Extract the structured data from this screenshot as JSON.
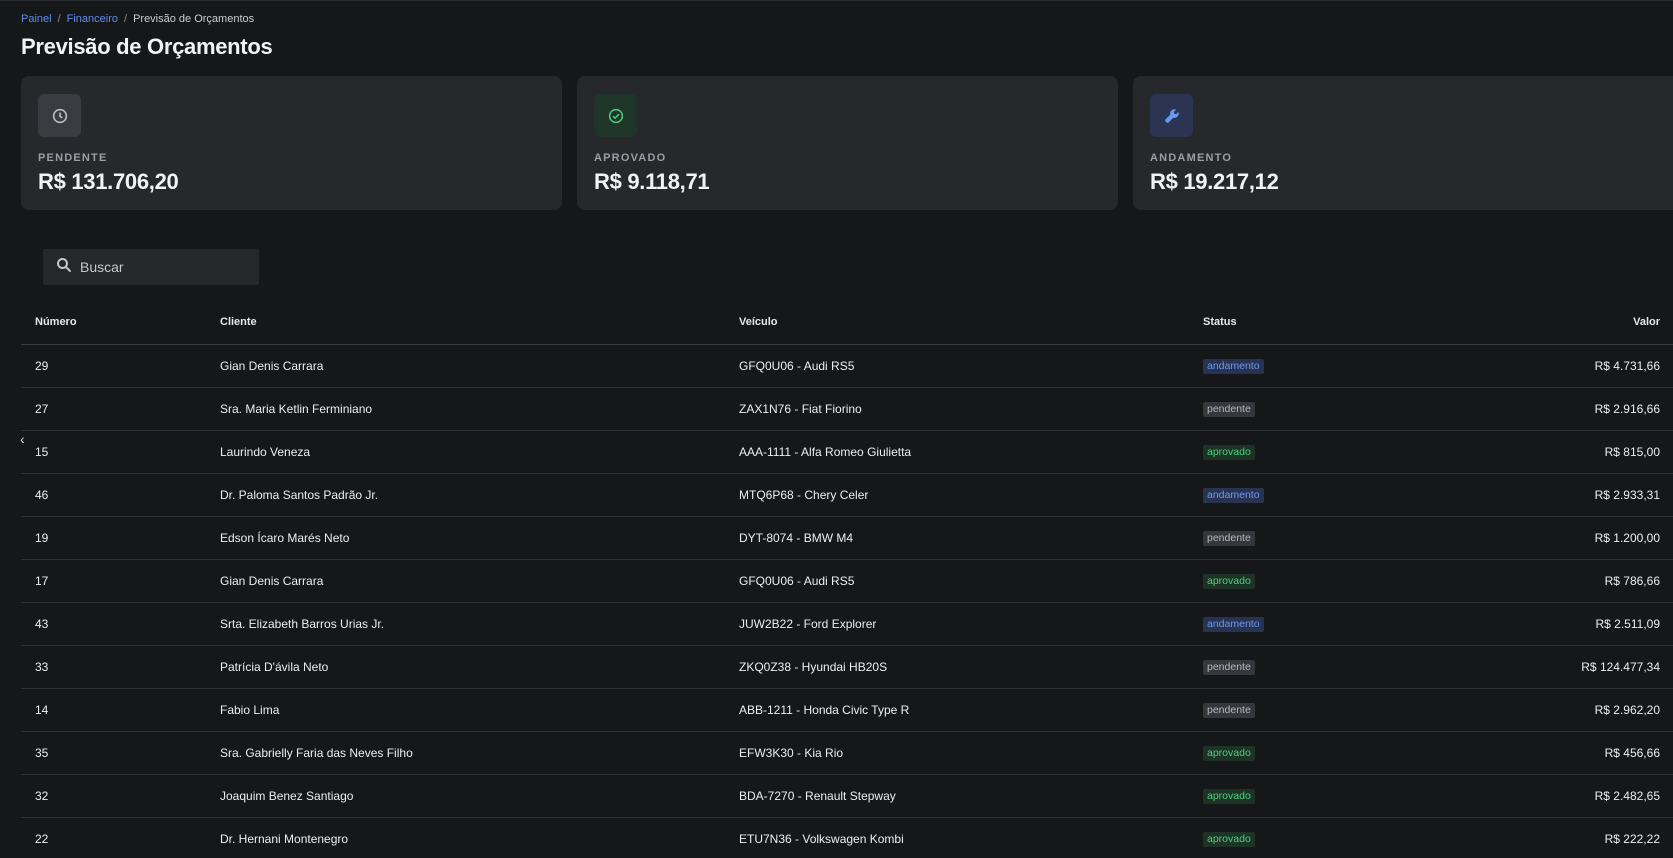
{
  "breadcrumb": {
    "items": [
      "Painel",
      "Financeiro"
    ],
    "current": "Previsão de Orçamentos",
    "separator": "/"
  },
  "page_title": "Previsão de Orçamentos",
  "cards": [
    {
      "key": "pendente",
      "icon": "clock-icon",
      "label": "PENDENTE",
      "value": "R$ 131.706,20"
    },
    {
      "key": "aprovado",
      "icon": "check-circle-icon",
      "label": "APROVADO",
      "value": "R$ 9.118,71"
    },
    {
      "key": "andamento",
      "icon": "wrench-icon",
      "label": "ANDAMENTO",
      "value": "R$ 19.217,12"
    }
  ],
  "search": {
    "placeholder": "Buscar",
    "value": ""
  },
  "table": {
    "headers": {
      "numero": "Número",
      "cliente": "Cliente",
      "veiculo": "Veículo",
      "status": "Status",
      "valor": "Valor"
    },
    "rows": [
      {
        "numero": "29",
        "cliente": "Gian Denis Carrara",
        "veiculo": "GFQ0U06 - Audi RS5",
        "status": "andamento",
        "valor": "R$ 4.731,66"
      },
      {
        "numero": "27",
        "cliente": "Sra. Maria Ketlin Ferminiano",
        "veiculo": "ZAX1N76 - Fiat Fiorino",
        "status": "pendente",
        "valor": "R$ 2.916,66"
      },
      {
        "numero": "15",
        "cliente": "Laurindo Veneza",
        "veiculo": "AAA-1111 - Alfa Romeo Giulietta",
        "status": "aprovado",
        "valor": "R$ 815,00"
      },
      {
        "numero": "46",
        "cliente": "Dr. Paloma Santos Padrão Jr.",
        "veiculo": "MTQ6P68 - Chery Celer",
        "status": "andamento",
        "valor": "R$ 2.933,31"
      },
      {
        "numero": "19",
        "cliente": "Edson Ícaro Marés Neto",
        "veiculo": "DYT-8074 - BMW M4",
        "status": "pendente",
        "valor": "R$ 1.200,00"
      },
      {
        "numero": "17",
        "cliente": "Gian Denis Carrara",
        "veiculo": "GFQ0U06 - Audi RS5",
        "status": "aprovado",
        "valor": "R$ 786,66"
      },
      {
        "numero": "43",
        "cliente": "Srta. Elizabeth Barros Urias Jr.",
        "veiculo": "JUW2B22 - Ford Explorer",
        "status": "andamento",
        "valor": "R$ 2.511,09"
      },
      {
        "numero": "33",
        "cliente": "Patrícia D'ávila Neto",
        "veiculo": "ZKQ0Z38 - Hyundai HB20S",
        "status": "pendente",
        "valor": "R$ 124.477,34"
      },
      {
        "numero": "14",
        "cliente": "Fabio Lima",
        "veiculo": "ABB-1211 - Honda Civic Type R",
        "status": "pendente",
        "valor": "R$ 2.962,20"
      },
      {
        "numero": "35",
        "cliente": "Sra. Gabrielly Faria das Neves Filho",
        "veiculo": "EFW3K30 - Kia Rio",
        "status": "aprovado",
        "valor": "R$ 456,66"
      },
      {
        "numero": "32",
        "cliente": "Joaquim Benez Santiago",
        "veiculo": "BDA-7270 - Renault Stepway",
        "status": "aprovado",
        "valor": "R$ 2.482,65"
      },
      {
        "numero": "22",
        "cliente": "Dr. Hernani Montenegro",
        "veiculo": "ETU7N36 - Volkswagen Kombi",
        "status": "aprovado",
        "valor": "R$ 222,22"
      }
    ]
  },
  "colors": {
    "background": "#161719",
    "card": "#26282c",
    "link": "#5b8dee",
    "andamento": "#6b98f2",
    "pendente": "#b4b7bd",
    "aprovado": "#4cd07d"
  }
}
